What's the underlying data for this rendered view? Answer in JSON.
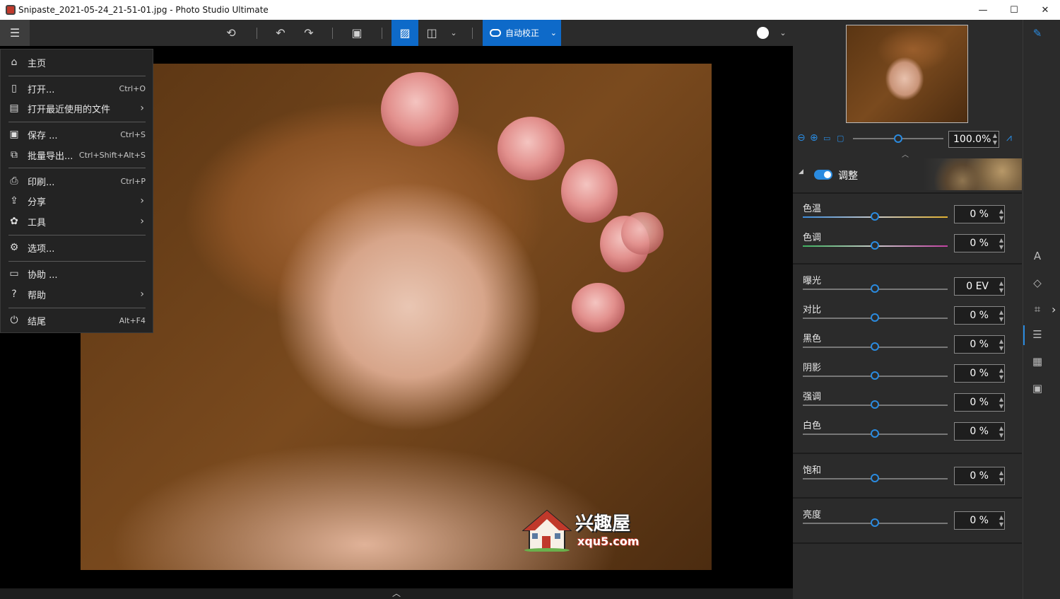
{
  "window": {
    "title": "Snipaste_2021-05-24_21-51-01.jpg - Photo Studio Ultimate",
    "minimize": "—",
    "maximize": "☐",
    "close": "✕"
  },
  "toolbar": {
    "auto_correct_label": "自动校正"
  },
  "menu": {
    "items": [
      {
        "label": "主页",
        "icon": "home-icon",
        "shortcut": ""
      },
      {
        "label": "打开...",
        "icon": "open-icon",
        "shortcut": "Ctrl+O"
      },
      {
        "label": "打开最近使用的文件",
        "icon": "recent-files-icon",
        "shortcut": ""
      },
      {
        "label": "保存 ...",
        "icon": "save-icon",
        "shortcut": "Ctrl+S"
      },
      {
        "label": "批量导出...",
        "icon": "batch-export-icon",
        "shortcut": "Ctrl+Shift+Alt+S"
      },
      {
        "label": "印刷...",
        "icon": "print-icon",
        "shortcut": "Ctrl+P"
      },
      {
        "label": "分享",
        "icon": "share-icon",
        "shortcut": ""
      },
      {
        "label": "工具",
        "icon": "tools-icon",
        "shortcut": ""
      },
      {
        "label": "选项...",
        "icon": "settings-icon",
        "shortcut": ""
      },
      {
        "label": "协助 ...",
        "icon": "assist-icon",
        "shortcut": ""
      },
      {
        "label": "帮助",
        "icon": "help-icon",
        "shortcut": ""
      },
      {
        "label": "结尾",
        "icon": "power-icon",
        "shortcut": "Alt+F4"
      }
    ]
  },
  "watermark": {
    "brand": "兴趣屋",
    "domain": "xqu5.com"
  },
  "panel": {
    "zoom_value": "100.0%",
    "adjust_title": "调整",
    "adjust_enabled": true,
    "sliders": {
      "color_temp": {
        "label": "色温",
        "value": "0 %",
        "level": 0.5
      },
      "tint": {
        "label": "色调",
        "value": "0 %",
        "level": 0.5
      },
      "exposure": {
        "label": "曝光",
        "value": "0 EV",
        "level": 0.5
      },
      "contrast": {
        "label": "对比",
        "value": "0 %",
        "level": 0.5
      },
      "blacks": {
        "label": "黑色",
        "value": "0 %",
        "level": 0.5
      },
      "shadows": {
        "label": "阴影",
        "value": "0 %",
        "level": 0.5
      },
      "highlights": {
        "label": "强调",
        "value": "0 %",
        "level": 0.5
      },
      "whites": {
        "label": "白色",
        "value": "0 %",
        "level": 0.5
      },
      "saturation": {
        "label": "饱和",
        "value": "0 %",
        "level": 0.5
      },
      "brightness": {
        "label": "亮度",
        "value": "0 %",
        "level": 0.5
      }
    }
  },
  "colors": {
    "accent": "#0e6ac9",
    "slider_knob": "#2a8be0",
    "panel_bg": "#2b2b2b"
  }
}
